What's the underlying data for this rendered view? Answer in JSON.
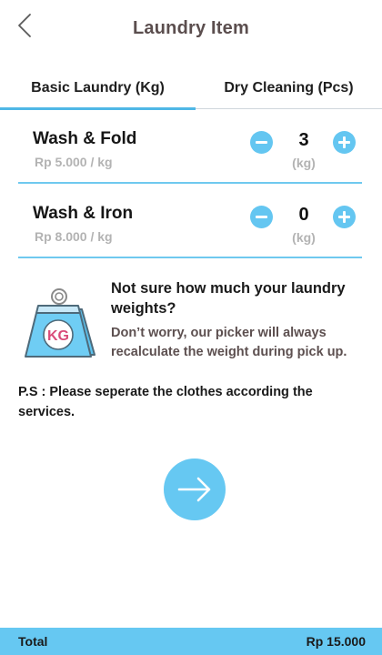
{
  "header": {
    "title": "Laundry Item",
    "back_icon": "chevron-left-icon"
  },
  "tabs": [
    {
      "label": "Basic Laundry (Kg)",
      "active": true
    },
    {
      "label": "Dry Cleaning (Pcs)",
      "active": false
    }
  ],
  "items": [
    {
      "name": "Wash & Fold",
      "price": "Rp 5.000 / kg",
      "quantity": "3",
      "unit": "(kg)"
    },
    {
      "name": "Wash & Iron",
      "price": "Rp 8.000 / kg",
      "quantity": "0",
      "unit": "(kg)"
    }
  ],
  "info": {
    "icon": "kg-weight-icon",
    "icon_label": "KG",
    "title": "Not sure how much your laundry weights?",
    "body": "Don’t worry, our picker will always recalculate the weight during pick up."
  },
  "note": "P.S : Please seperate the clothes according the services.",
  "next_button": {
    "icon": "arrow-right-icon"
  },
  "footer": {
    "label": "Total",
    "value": "Rp 15.000"
  },
  "colors": {
    "accent": "#64c6f1",
    "title": "#5b4e4e",
    "price_text": "#b3b3b3",
    "weight_pink": "#d94c7a"
  }
}
